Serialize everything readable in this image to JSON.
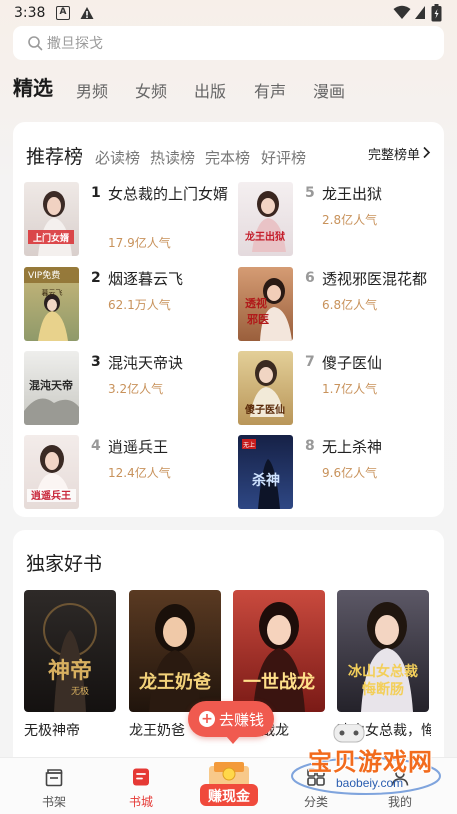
{
  "status_bar": {
    "time": "3:38",
    "icons": [
      "a-notification-icon",
      "warning-icon",
      "wifi-icon",
      "sim-icon",
      "battery-icon"
    ]
  },
  "search": {
    "placeholder": "撒旦探戈"
  },
  "category_tabs": [
    {
      "label": "精选",
      "active": true
    },
    {
      "label": "男频",
      "active": false
    },
    {
      "label": "女频",
      "active": false
    },
    {
      "label": "出版",
      "active": false
    },
    {
      "label": "有声",
      "active": false
    },
    {
      "label": "漫画",
      "active": false
    }
  ],
  "ranking": {
    "title": "推荐榜",
    "tabs": [
      "必读榜",
      "热读榜",
      "完本榜",
      "好评榜"
    ],
    "full_list": "完整榜单",
    "books": [
      {
        "rank": "1",
        "title": "女总裁的上门女婿",
        "popularity": "17.9亿人气",
        "cover_text": "上门女婿",
        "cover_color": "#e9e1dc"
      },
      {
        "rank": "2",
        "title": "烟逐暮云飞",
        "popularity": "62.1万人气",
        "cover_text": "暮云飞",
        "cover_badge": "VIP免费",
        "cover_color": "#c9b77a"
      },
      {
        "rank": "3",
        "title": "混沌天帝诀",
        "popularity": "3.2亿人气",
        "cover_text": "混沌天帝诀",
        "cover_color": "#d8d8d2"
      },
      {
        "rank": "4",
        "title": "逍遥兵王",
        "popularity": "12.4亿人气",
        "cover_text": "逍遥兵王",
        "cover_color": "#efe6e4"
      },
      {
        "rank": "5",
        "title": "龙王出狱",
        "popularity": "2.8亿人气",
        "cover_text": "龙王出狱",
        "cover_color": "#efe9ea"
      },
      {
        "rank": "6",
        "title": "透视邪医混花都",
        "popularity": "6.8亿人气",
        "cover_text": "透视邪医",
        "cover_color": "#c78b64"
      },
      {
        "rank": "7",
        "title": "傻子医仙",
        "popularity": "1.7亿人气",
        "cover_text": "傻子医仙",
        "cover_color": "#d9c28a"
      },
      {
        "rank": "8",
        "title": "无上杀神",
        "popularity": "9.6亿人气",
        "cover_text": "杀神",
        "cover_color": "#1e2c5a"
      }
    ]
  },
  "exclusive": {
    "title": "独家好书",
    "books": [
      {
        "title": "无极神帝",
        "cover_text": "神帝",
        "cover_color": "#2a2523"
      },
      {
        "title": "龙王奶爸",
        "cover_text": "龙王奶爸",
        "cover_color": "#3a2618"
      },
      {
        "title": "一世战龙",
        "cover_text": "一世战龙",
        "cover_color": "#b3342c"
      },
      {
        "title": "冰山女总裁，悔断肠",
        "cover_text": "冰山女总裁悔断肠",
        "cover_color": "#3d3a44"
      }
    ]
  },
  "earn_bubble": {
    "label": "去赚钱"
  },
  "bottom_nav": [
    {
      "label": "书架",
      "icon": "bookshelf-icon",
      "active": false
    },
    {
      "label": "书城",
      "icon": "bookstore-icon",
      "active": true
    },
    {
      "label": "赚现金",
      "icon": "earn-cash-icon",
      "active": false
    },
    {
      "label": "分类",
      "icon": "category-icon",
      "active": false
    },
    {
      "label": "我的",
      "icon": "profile-icon",
      "active": false
    }
  ],
  "watermark": {
    "text": "宝贝游戏网",
    "url": "baobeiy.com"
  },
  "colors": {
    "accent": "#e53935",
    "popularity": "#c8925b",
    "earn": "#f05a4f"
  }
}
